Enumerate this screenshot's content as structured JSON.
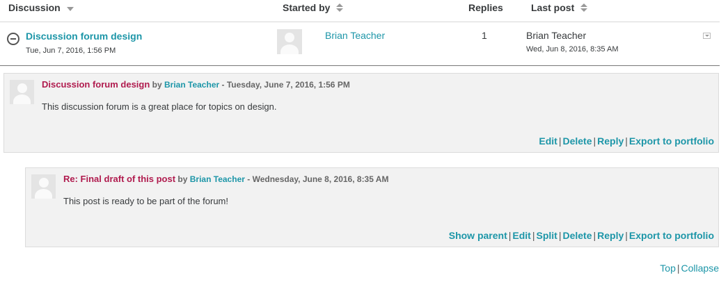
{
  "table": {
    "headers": {
      "discussion": "Discussion",
      "started_by": "Started by",
      "replies": "Replies",
      "last_post": "Last post"
    },
    "row": {
      "title": "Discussion forum design",
      "date": "Tue, Jun 7, 2016, 1:56 PM",
      "starter": "Brian Teacher",
      "replies": "1",
      "last_post_author": "Brian Teacher",
      "last_post_date": "Wed, Jun 8, 2016, 8:35 AM"
    }
  },
  "posts": [
    {
      "subject": "Discussion forum design",
      "by": "by",
      "author": "Brian Teacher",
      "date": "- Tuesday, June 7, 2016, 1:56 PM",
      "body": "This discussion forum is a great place for topics on design.",
      "commands": [
        "Edit",
        "Delete",
        "Reply",
        "Export to portfolio"
      ]
    },
    {
      "subject": "Re: Final draft of this post",
      "by": "by",
      "author": "Brian Teacher",
      "date": "- Wednesday, June 8, 2016, 8:35 AM",
      "body": "This post is ready to be part of the forum!",
      "commands": [
        "Show parent",
        "Edit",
        "Split",
        "Delete",
        "Reply",
        "Export to portfolio"
      ]
    }
  ],
  "footer": {
    "top": "Top",
    "collapse": "Collapse",
    "separator": "|"
  },
  "colors": {
    "link": "#1d96a8",
    "subject": "#b01b4e",
    "post_bg": "#f2f2f2"
  }
}
